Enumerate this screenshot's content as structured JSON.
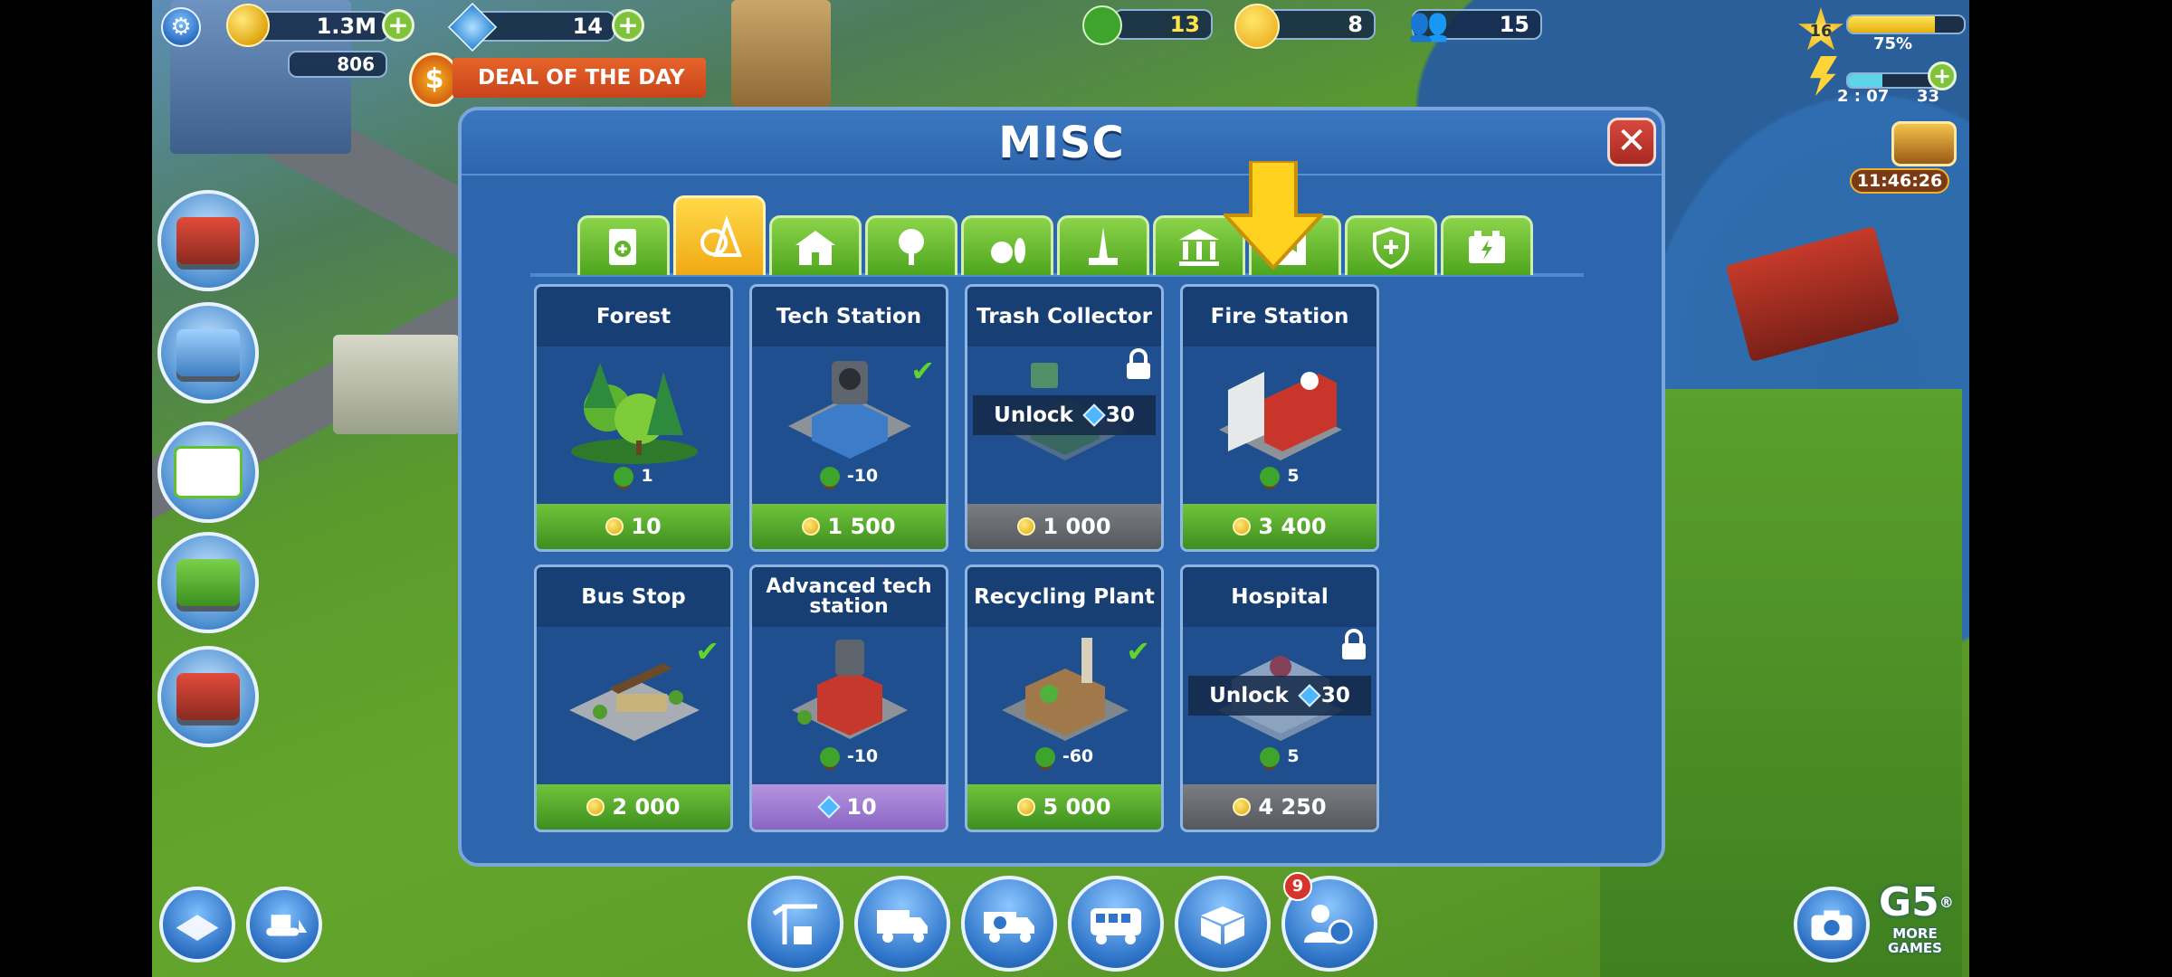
{
  "hud": {
    "coins": "1.3M",
    "gems": "14",
    "eco_small": "806",
    "deal_label": "DEAL OF THE DAY",
    "deal_badge": "$",
    "energy": "13",
    "happiness": "8",
    "population": "15",
    "level": "16",
    "xp_percent": "75%",
    "xp_fraction": 0.75,
    "timer": "2 : 07",
    "energy_count": "33",
    "chest_timer": "11:46:26"
  },
  "dialog": {
    "title": "MISC",
    "close_label": "✕",
    "tabs": [
      {
        "name": "tab-new",
        "icon": "document-plus-icon"
      },
      {
        "name": "tab-misc",
        "icon": "misc-shapes-icon",
        "active": true
      },
      {
        "name": "tab-residential",
        "icon": "house-icon"
      },
      {
        "name": "tab-parks",
        "icon": "tree-icon"
      },
      {
        "name": "tab-leisure",
        "icon": "bowling-icon"
      },
      {
        "name": "tab-landmarks",
        "icon": "tower-icon"
      },
      {
        "name": "tab-municipal",
        "icon": "bank-icon"
      },
      {
        "name": "tab-industry",
        "icon": "factory-icon"
      },
      {
        "name": "tab-services",
        "icon": "shield-plus-icon"
      },
      {
        "name": "tab-power",
        "icon": "battery-icon"
      }
    ],
    "cards": [
      {
        "title": "Forest",
        "eco": "1",
        "price": "10",
        "currency": "coin",
        "status": "available"
      },
      {
        "title": "Tech Station",
        "eco": "-10",
        "price": "1 500",
        "currency": "coin",
        "status": "owned"
      },
      {
        "title": "Trash Collector",
        "eco": "",
        "price": "1 000",
        "currency": "coin",
        "status": "locked",
        "unlock_label": "Unlock",
        "unlock_cost": "30"
      },
      {
        "title": "Fire Station",
        "eco": "5",
        "price": "3 400",
        "currency": "coin",
        "status": "available"
      },
      {
        "title": "Bus Stop",
        "eco": "",
        "price": "2 000",
        "currency": "coin",
        "status": "owned"
      },
      {
        "title": "Advanced tech station",
        "eco": "-10",
        "price": "10",
        "currency": "gem",
        "status": "available"
      },
      {
        "title": "Recycling Plant",
        "eco": "-60",
        "price": "5 000",
        "currency": "coin",
        "status": "owned"
      },
      {
        "title": "Hospital",
        "eco": "5",
        "price": "4 250",
        "currency": "coin",
        "status": "locked",
        "unlock_label": "Unlock",
        "unlock_cost": "30"
      }
    ]
  },
  "bottom_bar": {
    "notification_count": "9",
    "more_games_label": "MORE GAMES",
    "g5_label": "G5",
    "registered": "®"
  },
  "colors": {
    "dialog_bg": "#2e66ad",
    "tab_green": "#5fb52a",
    "tab_active": "#f6c12a",
    "price_green": "#4e9d25",
    "price_gray": "#66696e",
    "price_purple": "#9a78cf"
  }
}
